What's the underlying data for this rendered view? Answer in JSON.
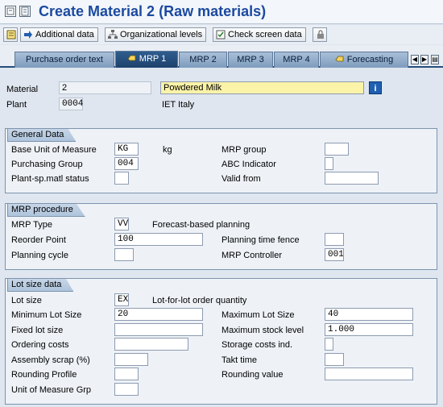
{
  "window": {
    "title": "Create Material 2 (Raw materials)"
  },
  "toolbar": {
    "additional_data": "Additional data",
    "org_levels": "Organizational levels",
    "check_screen_data": "Check screen data"
  },
  "tabs": [
    {
      "label": "Purchase order text",
      "active": false
    },
    {
      "label": "MRP 1",
      "active": true
    },
    {
      "label": "MRP 2",
      "active": false
    },
    {
      "label": "MRP 3",
      "active": false
    },
    {
      "label": "MRP 4",
      "active": false
    },
    {
      "label": "Forecasting",
      "active": false
    }
  ],
  "header": {
    "material_label": "Material",
    "material_value": "2",
    "description": "Powdered Milk",
    "plant_label": "Plant",
    "plant_value": "0004",
    "plant_name": "IET Italy"
  },
  "general": {
    "title": "General Data",
    "base_uom_label": "Base Unit of Measure",
    "base_uom_value": "KG",
    "base_uom_text": "kg",
    "mrp_group_label": "MRP group",
    "mrp_group_value": "",
    "purch_group_label": "Purchasing Group",
    "purch_group_value": "004",
    "abc_label": "ABC Indicator",
    "abc_value": "",
    "plant_status_label": "Plant-sp.matl status",
    "plant_status_value": "",
    "valid_from_label": "Valid from",
    "valid_from_value": ""
  },
  "mrp": {
    "title": "MRP procedure",
    "type_label": "MRP Type",
    "type_value": "VV",
    "type_text": "Forecast-based planning",
    "reorder_label": "Reorder Point",
    "reorder_value": "100",
    "fence_label": "Planning time fence",
    "fence_value": "",
    "cycle_label": "Planning cycle",
    "cycle_value": "",
    "controller_label": "MRP Controller",
    "controller_value": "001"
  },
  "lot": {
    "title": "Lot size data",
    "lot_label": "Lot size",
    "lot_value": "EX",
    "lot_text": "Lot-for-lot order quantity",
    "min_label": "Minimum Lot Size",
    "min_value": "20",
    "max_label": "Maximum Lot Size",
    "max_value": "40",
    "fixed_label": "Fixed lot size",
    "fixed_value": "",
    "max_stock_label": "Maximum stock level",
    "max_stock_value": "1.000",
    "ordering_label": "Ordering costs",
    "ordering_value": "",
    "storage_label": "Storage costs ind.",
    "storage_value": "",
    "scrap_label": "Assembly scrap (%)",
    "scrap_value": "",
    "takt_label": "Takt time",
    "takt_value": "",
    "rounding_profile_label": "Rounding Profile",
    "rounding_profile_value": "",
    "rounding_value_label": "Rounding value",
    "rounding_value_value": "",
    "uom_grp_label": "Unit of Measure Grp",
    "uom_grp_value": ""
  },
  "colors": {
    "title": "#1b4aa0",
    "tab_active": "#1e426c",
    "tab": "#8ea9c8",
    "highlight": "#fbf3a8"
  }
}
